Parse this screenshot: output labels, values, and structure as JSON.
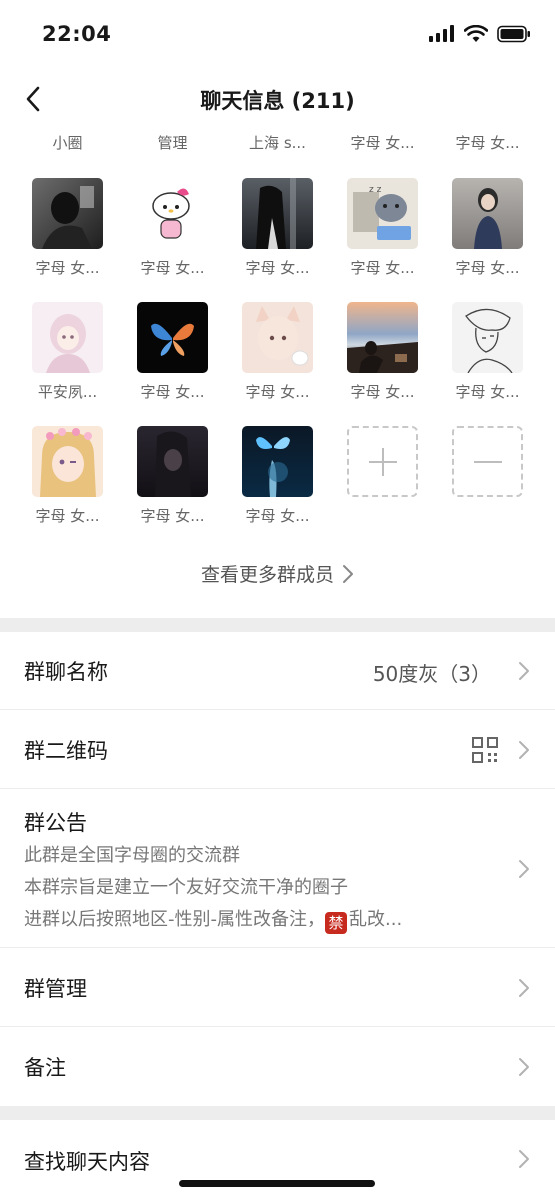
{
  "status_bar": {
    "time": "22:04"
  },
  "nav": {
    "title": "聊天信息 (211)"
  },
  "members_row0": [
    "小圈",
    "管理",
    "上海 s...",
    "字母 女...",
    "字母 女..."
  ],
  "members": [
    [
      "字母 女...",
      "字母 女...",
      "字母 女...",
      "字母 女...",
      "字母 女..."
    ],
    [
      "平安夙...",
      "字母 女...",
      "字母 女...",
      "字母 女...",
      "字母 女..."
    ],
    [
      "字母 女...",
      "字母 女...",
      "字母 女..."
    ]
  ],
  "view_more": "查看更多群成员",
  "group_name": {
    "label": "群聊名称",
    "value": "50度灰（3）"
  },
  "qr_code": {
    "label": "群二维码"
  },
  "notice": {
    "label": "群公告",
    "line1": "此群是全国字母圈的交流群",
    "line2": "本群宗旨是建立一个友好交流干净的圈子",
    "line3_prefix": "进群以后按照地区-性别-属性改备注，",
    "ban_char": "禁",
    "line3_suffix": "乱改..."
  },
  "management": {
    "label": "群管理"
  },
  "remark": {
    "label": "备注"
  },
  "search_chat": {
    "label": "查找聊天内容"
  },
  "colors": {
    "accent_red": "#c72b1f",
    "band": "#ededed"
  }
}
